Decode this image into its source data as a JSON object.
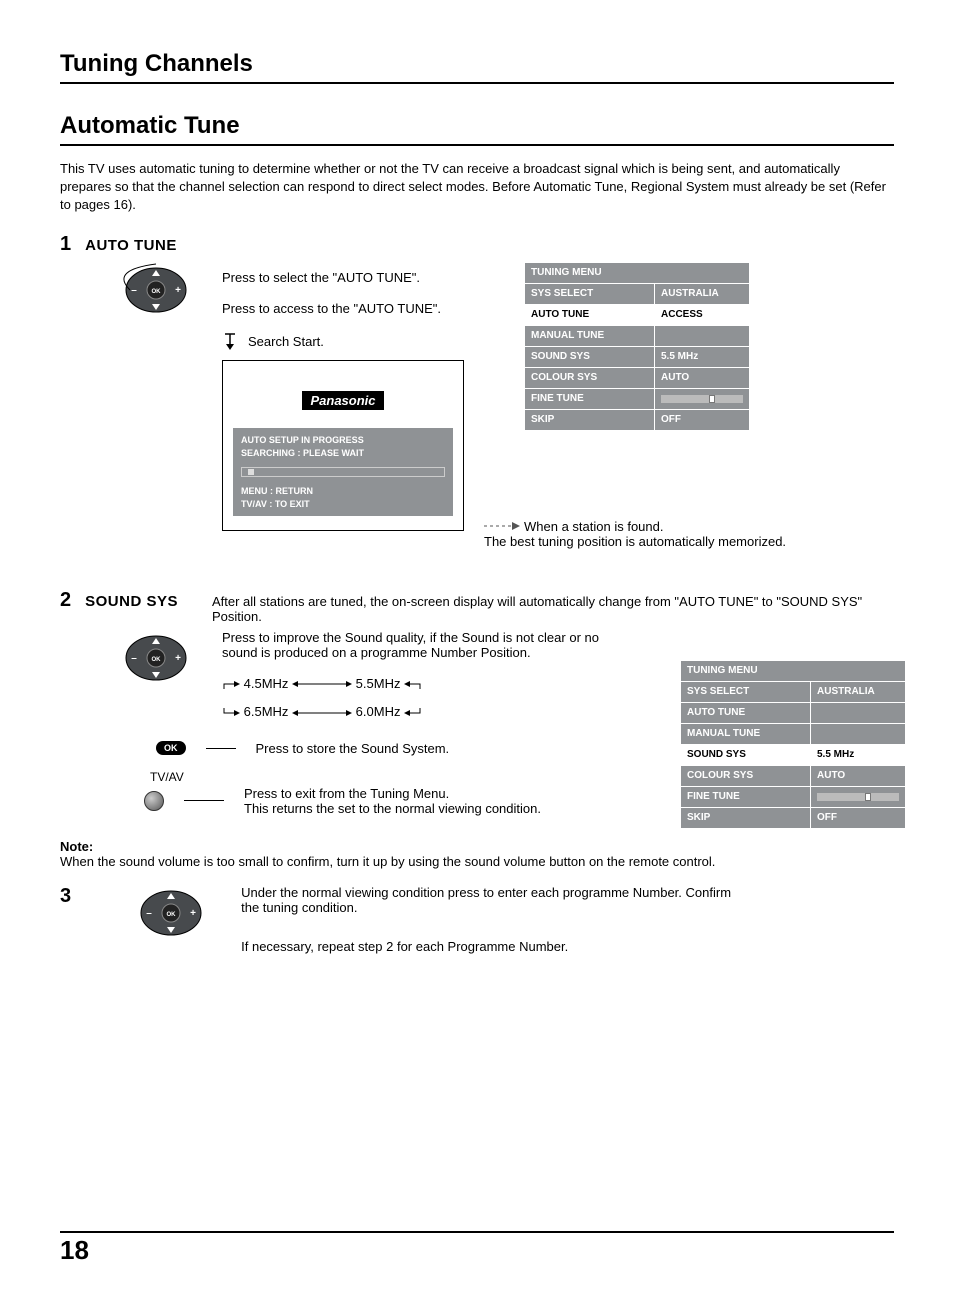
{
  "page_number": "18",
  "h1": "Tuning Channels",
  "h2": "Automatic Tune",
  "intro": "This TV uses automatic tuning to determine whether or not the TV can receive a broadcast signal which is being sent, and automatically prepares so that the channel selection can respond to direct select modes. Before Automatic Tune,  Regional System must already be set (Refer to pages 16).",
  "step1": {
    "num": "1",
    "title": "AUTO TUNE",
    "line_select": "Press to select the \"AUTO TUNE\".",
    "line_access": "Press to access to the \"AUTO TUNE\".",
    "search_start": "Search Start.",
    "logo": "Panasonic",
    "progress_l1": "AUTO SETUP IN PROGRESS",
    "progress_l2": "SEARCHING : PLEASE WAIT",
    "menu_return": "MENU  : RETURN",
    "tvav_exit": "TV/AV  : TO EXIT",
    "station_found": "When a station is found.",
    "memorized": "The best tuning position is automatically memorized."
  },
  "menu1": {
    "header": "TUNING MENU",
    "rows": [
      {
        "label": "SYS SELECT",
        "value": "AUSTRALIA",
        "hi": false
      },
      {
        "label": "AUTO TUNE",
        "value": "ACCESS",
        "hi": true
      },
      {
        "label": "MANUAL TUNE",
        "value": "",
        "hi": false
      },
      {
        "label": "SOUND  SYS",
        "value": "5.5 MHz",
        "hi": false
      },
      {
        "label": "COLOUR  SYS",
        "value": "AUTO",
        "hi": false
      },
      {
        "label": "FINE TUNE",
        "value": "__bar__",
        "hi": false
      },
      {
        "label": "SKIP",
        "value": "OFF",
        "hi": false
      }
    ]
  },
  "step2": {
    "num": "2",
    "title": "SOUND SYS",
    "intro": "After all stations are tuned, the on-screen display will automatically change from \"AUTO TUNE\" to \"SOUND SYS\" Position.",
    "line_improve": "Press to improve the Sound quality, if the Sound is not clear or no sound is produced on a programme Number Position.",
    "freq": {
      "a": "4.5MHz",
      "b": "5.5MHz",
      "c": "6.5MHz",
      "d": "6.0MHz"
    },
    "ok_store": "Press to store the Sound System.",
    "tvav_label": "TV/AV",
    "exit_l1": "Press to exit from the Tuning Menu.",
    "exit_l2": "This returns the set to the normal viewing condition."
  },
  "menu2": {
    "header": "TUNING MENU",
    "rows": [
      {
        "label": "SYS SELECT",
        "value": "AUSTRALIA",
        "hi": false
      },
      {
        "label": "AUTO TUNE",
        "value": "",
        "hi": false
      },
      {
        "label": "MANUAL TUNE",
        "value": "",
        "hi": false
      },
      {
        "label": "SOUND  SYS",
        "value": "5.5 MHz",
        "hi": true
      },
      {
        "label": "COLOUR  SYS",
        "value": "AUTO",
        "hi": false
      },
      {
        "label": "FINE TUNE",
        "value": "__bar__",
        "hi": false
      },
      {
        "label": "SKIP",
        "value": "OFF",
        "hi": false
      }
    ]
  },
  "note_label": "Note:",
  "note_text": "When the sound volume is too small to confirm, turn it up by using the sound volume button on the remote control.",
  "step3": {
    "num": "3",
    "line1": "Under the normal viewing condition press to enter each programme Number. Confirm the tuning condition.",
    "line2": "If necessary, repeat step 2 for each Programme Number."
  }
}
